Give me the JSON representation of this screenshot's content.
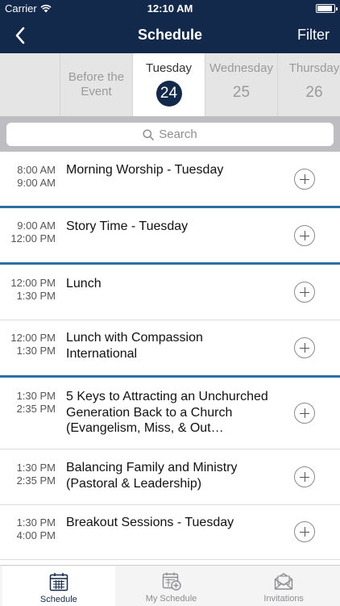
{
  "status_bar": {
    "carrier": "Carrier",
    "time": "12:10 AM"
  },
  "nav": {
    "title": "Schedule",
    "filter_label": "Filter"
  },
  "days": [
    {
      "label": "Before the Event",
      "number": ""
    },
    {
      "label": "Tuesday",
      "number": "24",
      "selected": true
    },
    {
      "label": "Wednesday",
      "number": "25"
    },
    {
      "label": "Thursday",
      "number": "26"
    }
  ],
  "search": {
    "placeholder": "Search"
  },
  "sessions": [
    {
      "start": "8:00 AM",
      "end": "9:00 AM",
      "title": "Morning Worship - Tuesday"
    },
    {
      "start": "9:00 AM",
      "end": "12:00 PM",
      "title": "Story Time - Tuesday"
    },
    {
      "start": "12:00 PM",
      "end": "1:30 PM",
      "title": "Lunch"
    },
    {
      "start": "12:00 PM",
      "end": "1:30 PM",
      "title": "Lunch with Compassion International"
    },
    {
      "start": "1:30 PM",
      "end": "2:35 PM",
      "title": "5 Keys to Attracting an Unchurched Generation Back to a Church (Evangelism, Miss, & Out…"
    },
    {
      "start": "1:30 PM",
      "end": "2:35 PM",
      "title": "Balancing Family and Ministry (Pastoral & Leadership)"
    },
    {
      "start": "1:30 PM",
      "end": "4:00 PM",
      "title": "Breakout Sessions - Tuesday"
    }
  ],
  "tabbar": [
    {
      "label": "Schedule",
      "icon": "calendar-icon",
      "active": true
    },
    {
      "label": "My Schedule",
      "icon": "calendar-add-icon"
    },
    {
      "label": "Invitations",
      "icon": "envelope-icon"
    }
  ],
  "colors": {
    "primary": "#13294b",
    "separator_accent": "#2d6ea3"
  }
}
